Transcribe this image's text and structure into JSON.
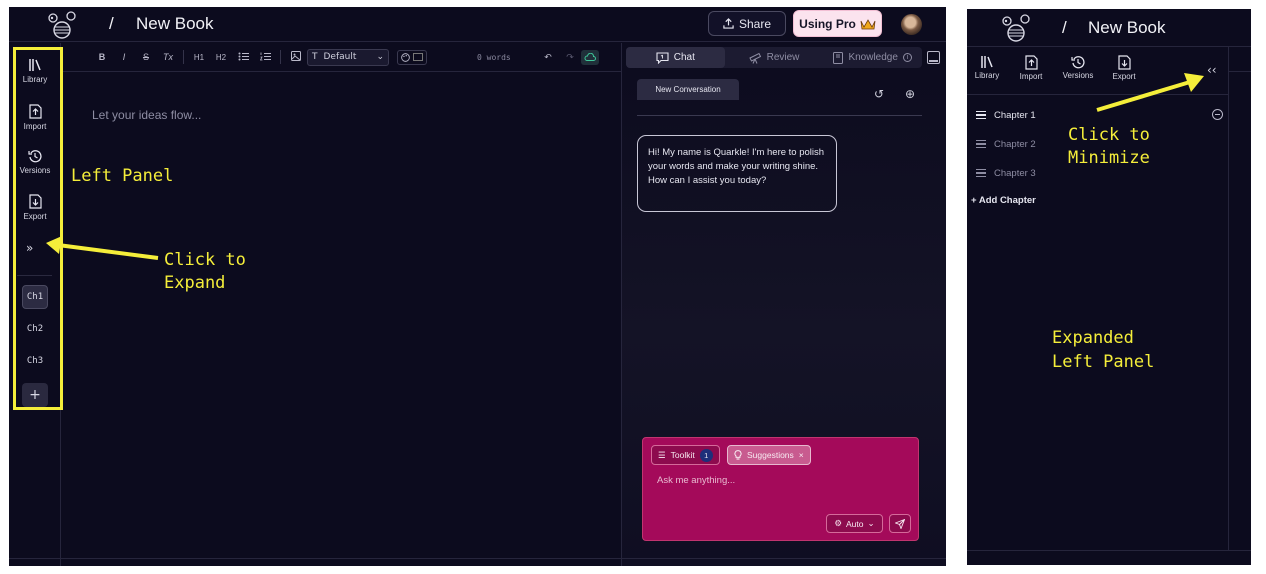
{
  "app": {
    "breadcrumb_sep": "/",
    "book_title": "New Book"
  },
  "header": {
    "share_label": "Share",
    "pro_label": "Using Pro",
    "pro_icon": "crown-icon"
  },
  "rail": {
    "items": [
      {
        "label": "Library",
        "icon": "library-icon"
      },
      {
        "label": "Import",
        "icon": "import-icon"
      },
      {
        "label": "Versions",
        "icon": "history-icon"
      },
      {
        "label": "Export",
        "icon": "export-icon"
      }
    ],
    "expand_glyph": "»",
    "chapters": [
      "Ch1",
      "Ch2",
      "Ch3"
    ],
    "active_chapter": "Ch1",
    "add_glyph": "+"
  },
  "toolbar": {
    "bold": "B",
    "italic": "I",
    "strike": "S",
    "clear": "Tx",
    "h1": "H1",
    "h2": "H2",
    "style_value": "Default",
    "word_count": "0 words"
  },
  "editor": {
    "placeholder": "Let your ideas flow..."
  },
  "chat": {
    "tabs": [
      {
        "label": "Chat",
        "icon": "chat-icon",
        "active": true
      },
      {
        "label": "Review",
        "icon": "telescope-icon",
        "active": false
      },
      {
        "label": "Knowledge",
        "icon": "book-icon",
        "active": false
      }
    ],
    "conversation_tab": "New Conversation",
    "greeting": "Hi! My name is Quarkle! I'm here to polish your words and make your writing shine. How can I assist you today?",
    "toolkit_label": "Toolkit",
    "toolkit_count": "1",
    "suggestions_label": "Suggestions",
    "input_placeholder": "Ask me anything...",
    "auto_label": "Auto"
  },
  "annotations": {
    "left_panel": "Left Panel",
    "click_expand_1": "Click to",
    "click_expand_2": "Expand",
    "click_min_1": "Click to",
    "click_min_2": "Minimize",
    "expanded_1": "Expanded",
    "expanded_2": "Left Panel",
    "color": "#f5ee3a"
  },
  "expanded": {
    "collapse_glyph": "‹‹",
    "chapters": [
      {
        "label": "Chapter 1",
        "active": true
      },
      {
        "label": "Chapter 2",
        "active": false
      },
      {
        "label": "Chapter 3",
        "active": false
      }
    ],
    "add_chapter": "+ Add Chapter"
  }
}
